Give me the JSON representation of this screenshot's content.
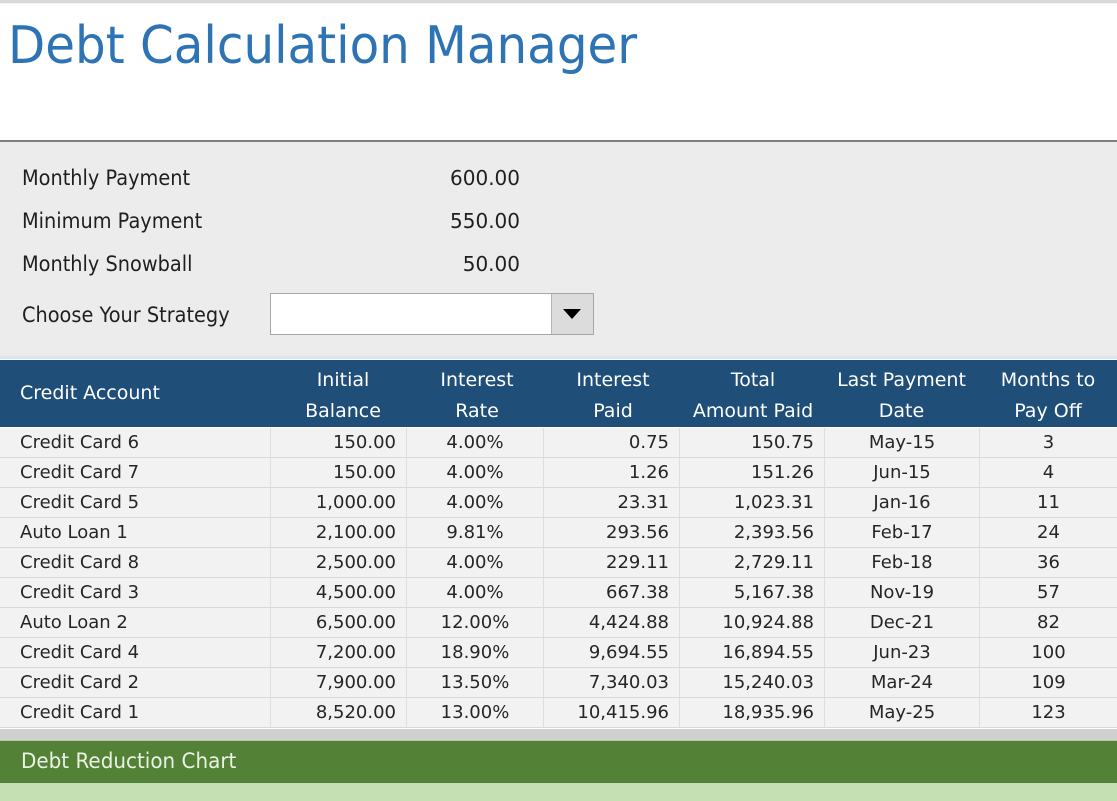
{
  "title": "Debt Calculation Manager",
  "inputs": {
    "monthly_payment": {
      "label": "Monthly Payment",
      "value": "600.00"
    },
    "minimum_payment": {
      "label": "Minimum Payment",
      "value": "550.00"
    },
    "monthly_snowball": {
      "label": "Monthly Snowball",
      "value": "50.00"
    },
    "strategy": {
      "label": "Choose Your Strategy",
      "value": "",
      "icon": "dropdown-arrow-icon"
    }
  },
  "table": {
    "headers": [
      {
        "line1": "Credit Account",
        "line2": ""
      },
      {
        "line1": "Initial",
        "line2": "Balance"
      },
      {
        "line1": "Interest",
        "line2": "Rate"
      },
      {
        "line1": "Interest",
        "line2": "Paid"
      },
      {
        "line1": "Total",
        "line2": "Amount Paid"
      },
      {
        "line1": "Last Payment",
        "line2": "Date"
      },
      {
        "line1": "Months to",
        "line2": "Pay Off"
      }
    ],
    "rows": [
      [
        "Credit Card 6",
        "150.00",
        "4.00%",
        "0.75",
        "150.75",
        "May-15",
        "3"
      ],
      [
        "Credit Card 7",
        "150.00",
        "4.00%",
        "1.26",
        "151.26",
        "Jun-15",
        "4"
      ],
      [
        "Credit Card 5",
        "1,000.00",
        "4.00%",
        "23.31",
        "1,023.31",
        "Jan-16",
        "11"
      ],
      [
        "Auto Loan 1",
        "2,100.00",
        "9.81%",
        "293.56",
        "2,393.56",
        "Feb-17",
        "24"
      ],
      [
        "Credit Card 8",
        "2,500.00",
        "4.00%",
        "229.11",
        "2,729.11",
        "Feb-18",
        "36"
      ],
      [
        "Credit Card 3",
        "4,500.00",
        "4.00%",
        "667.38",
        "5,167.38",
        "Nov-19",
        "57"
      ],
      [
        "Auto Loan 2",
        "6,500.00",
        "12.00%",
        "4,424.88",
        "10,924.88",
        "Dec-21",
        "82"
      ],
      [
        "Credit Card 4",
        "7,200.00",
        "18.90%",
        "9,694.55",
        "16,894.55",
        "Jun-23",
        "100"
      ],
      [
        "Credit Card 2",
        "7,900.00",
        "13.50%",
        "7,340.03",
        "15,240.03",
        "Mar-24",
        "109"
      ],
      [
        "Credit Card 1",
        "8,520.00",
        "13.00%",
        "10,415.96",
        "18,935.96",
        "May-25",
        "123"
      ]
    ]
  },
  "chart_section": {
    "title": "Debt Reduction Chart"
  },
  "colors": {
    "title": "#2e74b5",
    "table_header": "#1f4e79",
    "section_header": "#538135",
    "section_body": "#c5e0b3",
    "panel": "#ececec"
  }
}
